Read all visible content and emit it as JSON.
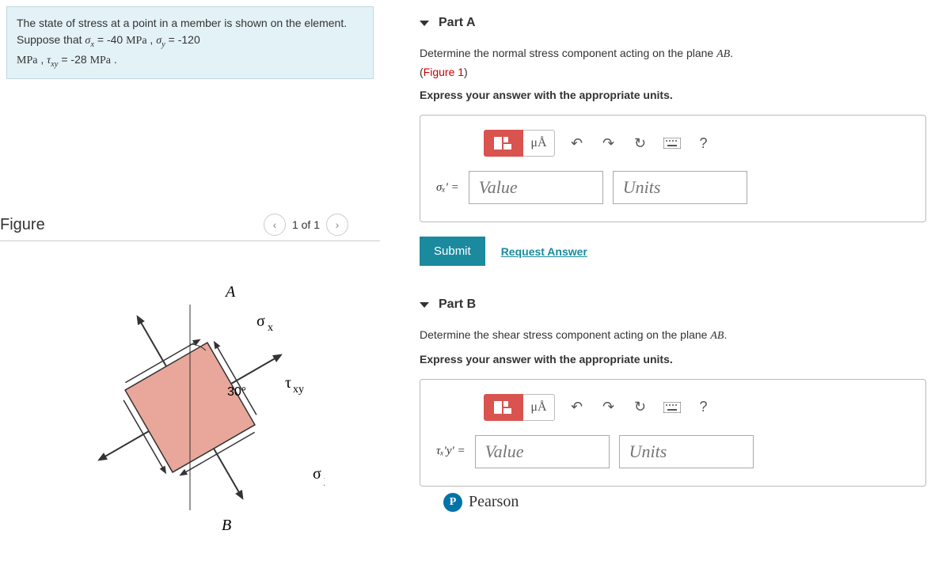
{
  "problem": {
    "line1a": "The state of stress at a point in a member is shown on the element. Suppose that ",
    "sigma_x_lbl": "σ",
    "sigma_x_sub": "x",
    "eq_neg40": " = -40 ",
    "mpa": "MPa",
    "comma_sp": " , ",
    "sigma_y_lbl": "σ",
    "sigma_y_sub": "y",
    "eq_neg120": " = -120 ",
    "tau_lbl": "τ",
    "tau_sub": "xy",
    "eq_neg28": " = -28 ",
    "period": " ."
  },
  "figure": {
    "title": "Figure",
    "pager": "1 of 1",
    "labels": {
      "A": "A",
      "B": "B",
      "ox": "σ",
      "ox_sub": "x",
      "oy": "σ",
      "oy_sub": "y",
      "txy": "τ",
      "txy_sub": "xy",
      "angle": "30°"
    }
  },
  "partA": {
    "title": "Part A",
    "prompt1": "Determine the normal stress component acting on the plane ",
    "ab": "AB",
    "prompt1_end": ".",
    "figref_open": "(",
    "figref": "Figure 1",
    "figref_close": ")",
    "prompt2": "Express your answer with the appropriate units.",
    "eq_label": "σₓ' =",
    "value_ph": "Value",
    "units_ph": "Units",
    "submit": "Submit",
    "request": "Request Answer",
    "mu_a": "μÅ",
    "help": "?"
  },
  "partB": {
    "title": "Part B",
    "prompt1": "Determine the shear stress component acting on the plane ",
    "ab": "AB",
    "prompt1_end": ".",
    "prompt2": "Express your answer with the appropriate units.",
    "eq_label": "τₓ'y' =",
    "value_ph": "Value",
    "units_ph": "Units",
    "mu_a": "μÅ",
    "help": "?"
  },
  "pearson": {
    "icon": "P",
    "text": "Pearson"
  }
}
